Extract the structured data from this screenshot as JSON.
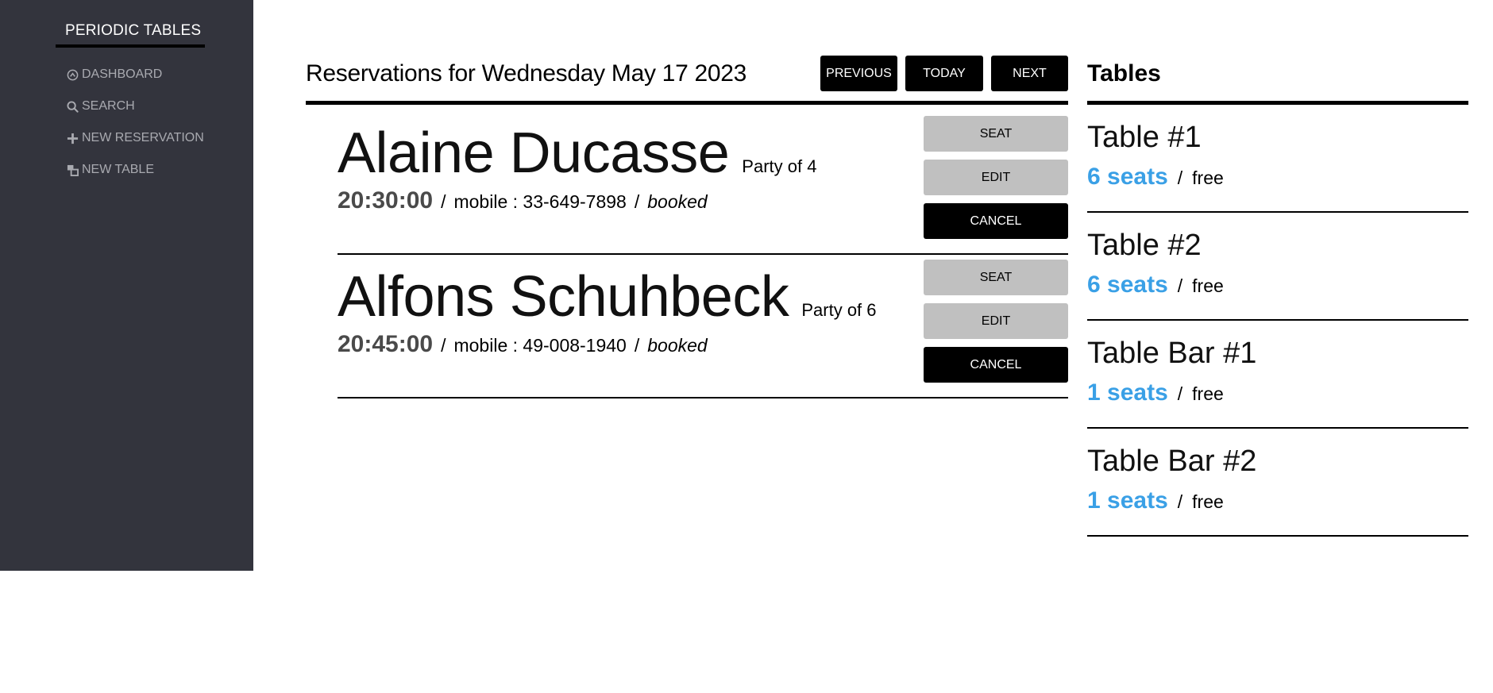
{
  "sidebar": {
    "brand": "PERIODIC TABLES",
    "items": [
      {
        "label": "DASHBOARD",
        "icon": "dashboard-icon"
      },
      {
        "label": "SEARCH",
        "icon": "search-icon"
      },
      {
        "label": "NEW RESERVATION",
        "icon": "plus-icon"
      },
      {
        "label": "NEW TABLE",
        "icon": "table-icon"
      }
    ]
  },
  "reservations": {
    "title": "Reservations for Wednesday May 17 2023",
    "buttons": {
      "previous": "PREVIOUS",
      "today": "TODAY",
      "next": "NEXT"
    },
    "items": [
      {
        "name": "Alaine Ducasse",
        "party": "Party of 4",
        "time": "20:30:00",
        "mobile": "mobile : 33-649-7898",
        "status": "booked",
        "actions": {
          "seat": "SEAT",
          "edit": "EDIT",
          "cancel": "CANCEL"
        }
      },
      {
        "name": "Alfons Schuhbeck",
        "party": "Party of 6",
        "time": "20:45:00",
        "mobile": "mobile : 49-008-1940",
        "status": "booked",
        "actions": {
          "seat": "SEAT",
          "edit": "EDIT",
          "cancel": "CANCEL"
        }
      }
    ]
  },
  "tables": {
    "title": "Tables",
    "items": [
      {
        "name": "Table #1",
        "seats": "6 seats",
        "status": "free"
      },
      {
        "name": "Table #2",
        "seats": "6 seats",
        "status": "free"
      },
      {
        "name": "Table Bar #1",
        "seats": "1 seats",
        "status": "free"
      },
      {
        "name": "Table Bar #2",
        "seats": "1 seats",
        "status": "free"
      }
    ]
  },
  "colors": {
    "sidebar_bg": "#33343d",
    "accent": "#3aa0e6",
    "button_dark": "#000000",
    "button_light": "#c0c0c0"
  }
}
